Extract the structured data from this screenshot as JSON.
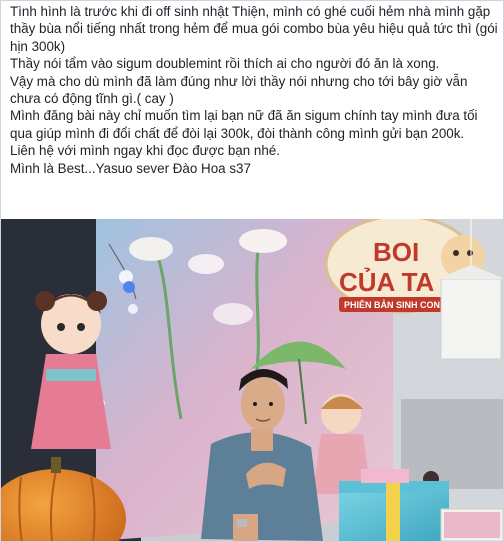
{
  "post": {
    "paragraphs": [
      "Tình hình là trước khi đi off sinh nhật Thiện, mình có ghé cuối hẻm nhà mình gặp thầy bùa nổi tiếng nhất trong hẻm để mua gói combo bùa yêu hiệu quả tức thì (gói hịn 300k)",
      "Thầy nói tẩm vào sigum doublemint rồi thích ai cho người đó ăn là xong.",
      "Vậy mà cho dù mình đã làm đúng như lời thầy nói nhưng cho tới bây giờ vẫn chưa có động tĩnh gì.( cay )",
      "Mình đăng bài này chỉ muốn tìm lại bạn nữ đã ăn sigum chính tay mình đưa tối qua giúp mình đi đổi chất để đòi lại 300k, đòi thành công mình gửi bạn 200k.",
      "Liên hệ với mình ngay khi đọc được bạn nhé.",
      "Mình là Best...Yasuo sever Đào Hoa s37"
    ]
  },
  "photo": {
    "sign_title_line1": "BOI",
    "sign_title_line2": "CỦA TA",
    "sign_subtitle": "PHIÊN BẢN SINH CON"
  },
  "colors": {
    "text": "#1d2129",
    "sign_red": "#c0392b",
    "sign_bg": "#f6ead2",
    "pumpkin": "#e8891f",
    "mural_pink": "#e8b9c8",
    "mural_blue": "#8fb6d6",
    "wall": "#dadcdf"
  }
}
